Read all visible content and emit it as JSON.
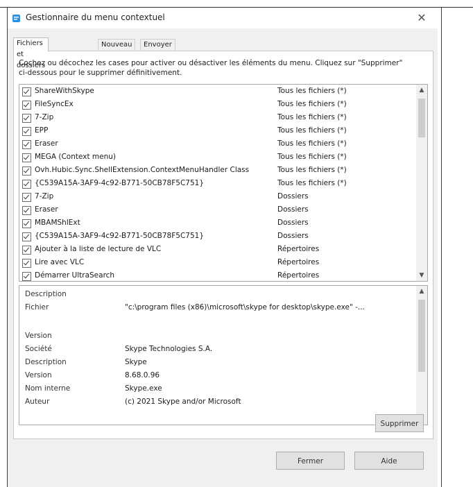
{
  "window": {
    "title": "Gestionnaire du menu contextuel",
    "close_glyph": "✕"
  },
  "tabs": [
    {
      "label": "Fichiers et dossiers",
      "active": true
    },
    {
      "label": "Nouveau",
      "active": false
    },
    {
      "label": "Envoyer vers",
      "active": false
    }
  ],
  "instructions": "Cochez ou décochez les cases pour activer ou désactiver les éléments du menu. Cliquez sur \"Supprimer\" ci-dessous pour le supprimer définitivement.",
  "items": [
    {
      "name": "ShareWithSkype",
      "type": "Tous les fichiers (*)",
      "checked": true
    },
    {
      "name": "FileSyncEx",
      "type": "Tous les fichiers (*)",
      "checked": true
    },
    {
      "name": "7-Zip",
      "type": "Tous les fichiers (*)",
      "checked": true
    },
    {
      "name": "EPP",
      "type": "Tous les fichiers (*)",
      "checked": true
    },
    {
      "name": "Eraser",
      "type": "Tous les fichiers (*)",
      "checked": true
    },
    {
      "name": "MEGA (Context menu)",
      "type": "Tous les fichiers (*)",
      "checked": true
    },
    {
      "name": "Ovh.Hubic.Sync.ShellExtension.ContextMenuHandler Class",
      "type": "Tous les fichiers (*)",
      "checked": true
    },
    {
      "name": "{C539A15A-3AF9-4c92-B771-50CB78F5C751}",
      "type": "Tous les fichiers (*)",
      "checked": true
    },
    {
      "name": "7-Zip",
      "type": "Dossiers",
      "checked": true
    },
    {
      "name": "Eraser",
      "type": "Dossiers",
      "checked": true
    },
    {
      "name": "MBAMShlExt",
      "type": "Dossiers",
      "checked": true
    },
    {
      "name": "{C539A15A-3AF9-4c92-B771-50CB78F5C751}",
      "type": "Dossiers",
      "checked": true
    },
    {
      "name": "Ajouter à la liste de lecture de VLC",
      "type": "Répertoires",
      "checked": true
    },
    {
      "name": "Lire avec VLC",
      "type": "Répertoires",
      "checked": true
    },
    {
      "name": "Démarrer UltraSearch",
      "type": "Répertoires",
      "checked": true
    }
  ],
  "description": {
    "rows": [
      {
        "label": "Description",
        "value": ""
      },
      {
        "label": "Fichier",
        "value": "\"c:\\program files (x86)\\microsoft\\skype for desktop\\skype.exe\" -..."
      },
      {
        "label": "",
        "value": ""
      },
      {
        "label": "Version",
        "value": ""
      },
      {
        "label": "Société",
        "value": "Skype Technologies S.A."
      },
      {
        "label": "Description",
        "value": "Skype"
      },
      {
        "label": "Version",
        "value": "8.68.0.96"
      },
      {
        "label": "Nom interne",
        "value": "Skype.exe"
      },
      {
        "label": "Auteur",
        "value": "(c) 2021 Skype and/or Microsoft"
      }
    ]
  },
  "buttons": {
    "delete": "Supprimer",
    "close": "Fermer",
    "help": "Aide"
  },
  "scroll": {
    "up": "▲",
    "down": "▼",
    "list_position": 0.0,
    "desc_position": 0.0
  },
  "colors": {
    "accent_icon": "#2f8fe0",
    "window_bg": "#f0f0f0"
  },
  "icons": [
    "app-icon",
    "close-icon",
    "checkbox-icon",
    "scroll-up-icon",
    "scroll-down-icon"
  ]
}
